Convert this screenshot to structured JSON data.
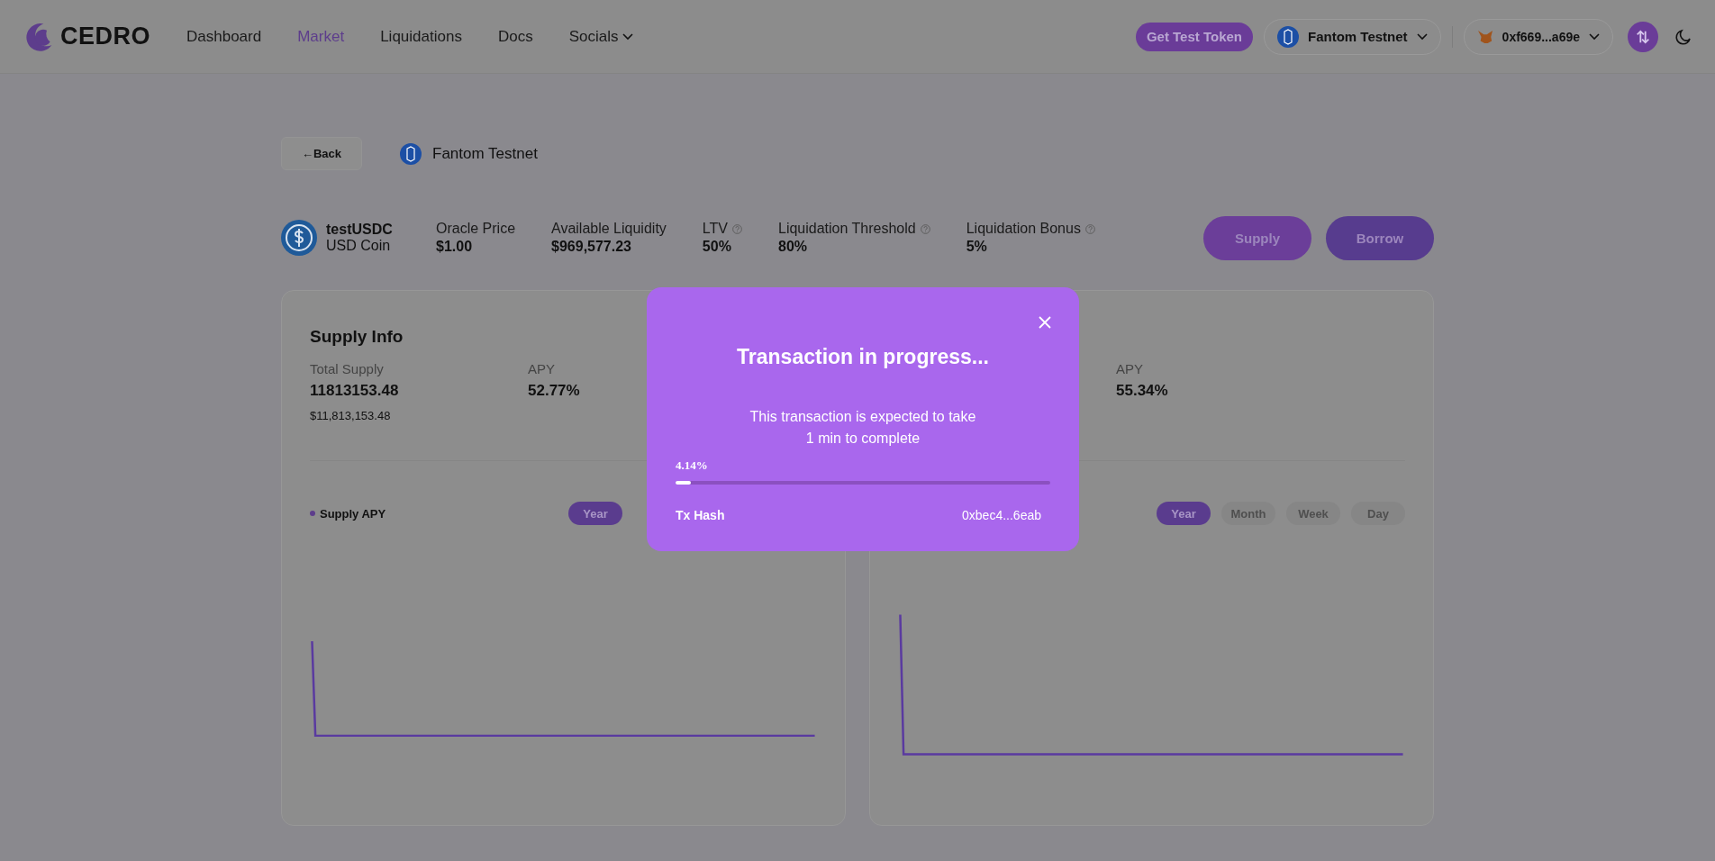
{
  "header": {
    "logo": "CEDRO",
    "nav": [
      {
        "label": "Dashboard",
        "selected": false,
        "kind": "link"
      },
      {
        "label": "Market",
        "selected": true,
        "kind": "link"
      },
      {
        "label": "Liquidations",
        "selected": false,
        "kind": "link"
      },
      {
        "label": "Docs",
        "selected": false,
        "kind": "link"
      },
      {
        "label": "Socials",
        "selected": false,
        "kind": "dropdown"
      }
    ],
    "test_token_button": "Get Test Token",
    "network": "Fantom Testnet",
    "wallet": "0xf669...a69e"
  },
  "back_button": "←Back",
  "network_label": "Fantom Testnet",
  "asset": {
    "symbol": "testUSDC",
    "name": "USD Coin",
    "stats": [
      {
        "label": "Oracle Price",
        "value": "$1.00",
        "info": false
      },
      {
        "label": "Available Liquidity",
        "value": "$969,577.23",
        "info": false
      },
      {
        "label": "LTV",
        "value": "50%",
        "info": true
      },
      {
        "label": "Liquidation Threshold",
        "value": "80%",
        "info": true
      },
      {
        "label": "Liquidation Bonus",
        "value": "5%",
        "info": true
      }
    ],
    "actions": [
      "Supply",
      "Borrow"
    ]
  },
  "cards": [
    {
      "title": "Supply Info",
      "stats": [
        {
          "label": "Total Supply",
          "value": "11813153.48",
          "sub": "$11,813,153.48"
        },
        {
          "label": "APY",
          "value": "52.77%"
        }
      ],
      "legend": "Supply APY",
      "periods": [
        {
          "label": "Year",
          "selected": true
        }
      ]
    },
    {
      "stats": [
        {
          "label": "APY",
          "value": "55.34%"
        }
      ],
      "periods": [
        {
          "label": "Year",
          "selected": true
        },
        {
          "label": "Month",
          "selected": false
        },
        {
          "label": "Week",
          "selected": false
        },
        {
          "label": "Day",
          "selected": false
        }
      ]
    }
  ],
  "modal": {
    "title": "Transaction in progress...",
    "message": [
      "This transaction is expected to take",
      "1 min to complete"
    ],
    "progress_label": "4.14%",
    "level": 0.0414,
    "hash_label": "Tx Hash",
    "hash_value": "0xbec4...6eab"
  }
}
